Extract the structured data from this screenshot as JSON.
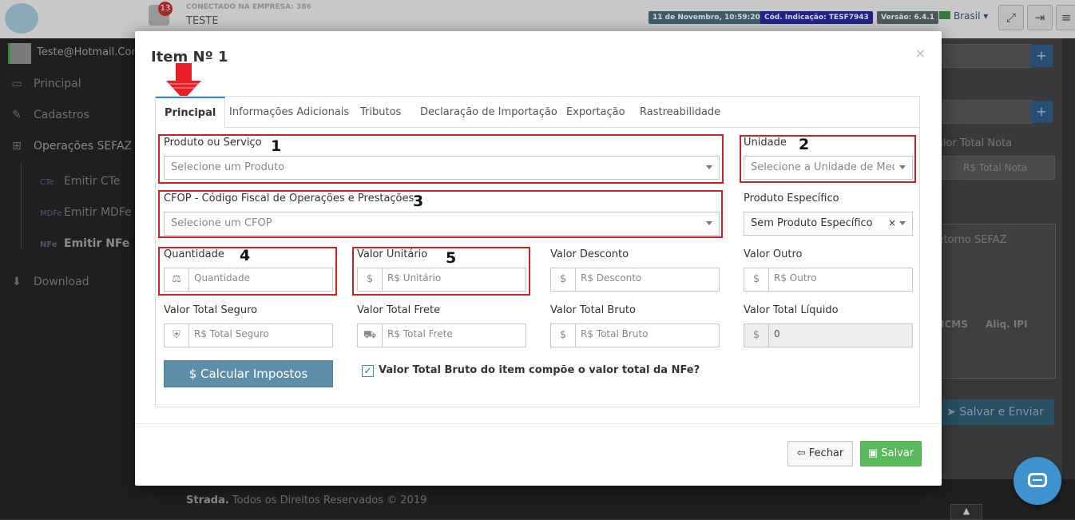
{
  "topbar": {
    "notification_count": "13",
    "connected_label": "CONECTADO NA EMPRESA: 386",
    "company_name": "TESTE",
    "date_tag": "11 de Novembro, 10:59:20",
    "indication_tag": "Cód. Indicação: TESF7943",
    "version_tag": "Versão: 6.4.1",
    "language": "Brasil"
  },
  "sidebar": {
    "user": "Teste@Hotmail.Com",
    "items": [
      {
        "label": "Principal",
        "icon": "laptop-icon"
      },
      {
        "label": "Cadastros",
        "icon": "edit-icon"
      },
      {
        "label": "Operações SEFAZ",
        "icon": "windows-icon"
      },
      {
        "label": "Download",
        "icon": "download-icon"
      }
    ],
    "subitems": [
      {
        "label": "Emitir CTe",
        "badge": "CTe"
      },
      {
        "label": "Emitir MDFe",
        "badge": "MDFe"
      },
      {
        "label": "Emitir NFe",
        "badge": "NFe"
      }
    ]
  },
  "background": {
    "valor_total_nota_label": "Valor Total Nota",
    "valor_total_nota_placeholder": "R$ Total Nota",
    "retorno_label": "Retorno SEFAZ",
    "col_icms": "ICMS",
    "col_ipi": "Aliq. IPI",
    "save_send": "Salvar e Enviar"
  },
  "footer": {
    "brand": "Strada.",
    "text": " Todos os Direitos Reservados © 2019"
  },
  "modal": {
    "title": "Item Nº 1",
    "close_glyph": "×",
    "tabs": [
      "Principal",
      "Informações Adicionais",
      "Tributos",
      "Declaração de Importação",
      "Exportação",
      "Rastreabilidade"
    ],
    "fields": {
      "produto": {
        "label": "Produto ou Serviço",
        "placeholder": "Selecione um Produto"
      },
      "unidade": {
        "label": "Unidade",
        "placeholder": "Selecione a Unidade de Med..."
      },
      "cfop": {
        "label": "CFOP - Código Fiscal de Operações e Prestações",
        "placeholder": "Selecione um CFOP"
      },
      "produto_especifico": {
        "label": "Produto Específico",
        "value": "Sem Produto Específico",
        "clear": "×"
      },
      "quantidade": {
        "label": "Quantidade",
        "placeholder": "Quantidade"
      },
      "valor_unitario": {
        "label": "Valor Unitário",
        "placeholder": "R$ Unitário"
      },
      "valor_desconto": {
        "label": "Valor Desconto",
        "placeholder": "R$ Desconto"
      },
      "valor_outro": {
        "label": "Valor Outro",
        "placeholder": "R$ Outro"
      },
      "valor_total_seguro": {
        "label": "Valor Total Seguro",
        "placeholder": "R$ Total Seguro"
      },
      "valor_total_frete": {
        "label": "Valor Total Frete",
        "placeholder": "R$ Total Frete"
      },
      "valor_total_bruto": {
        "label": "Valor Total Bruto",
        "placeholder": "R$ Total Bruto"
      },
      "valor_total_liquido": {
        "label": "Valor Total Líquido",
        "value": "0"
      }
    },
    "currency_symbol": "$",
    "calc_button": "$ Calcular Impostos",
    "checkbox_label": "Valor Total Bruto do item compõe o valor total da NFe?",
    "checkbox_checked": true,
    "annotations": [
      "1",
      "2",
      "3",
      "4",
      "5"
    ],
    "buttons": {
      "close": "Fechar",
      "save": "Salvar"
    }
  },
  "colors": {
    "annotation_red": "#d11f26",
    "primary": "#3c8dbc",
    "calc_button": "#5f8ea8",
    "save_button": "#5cb85c"
  }
}
